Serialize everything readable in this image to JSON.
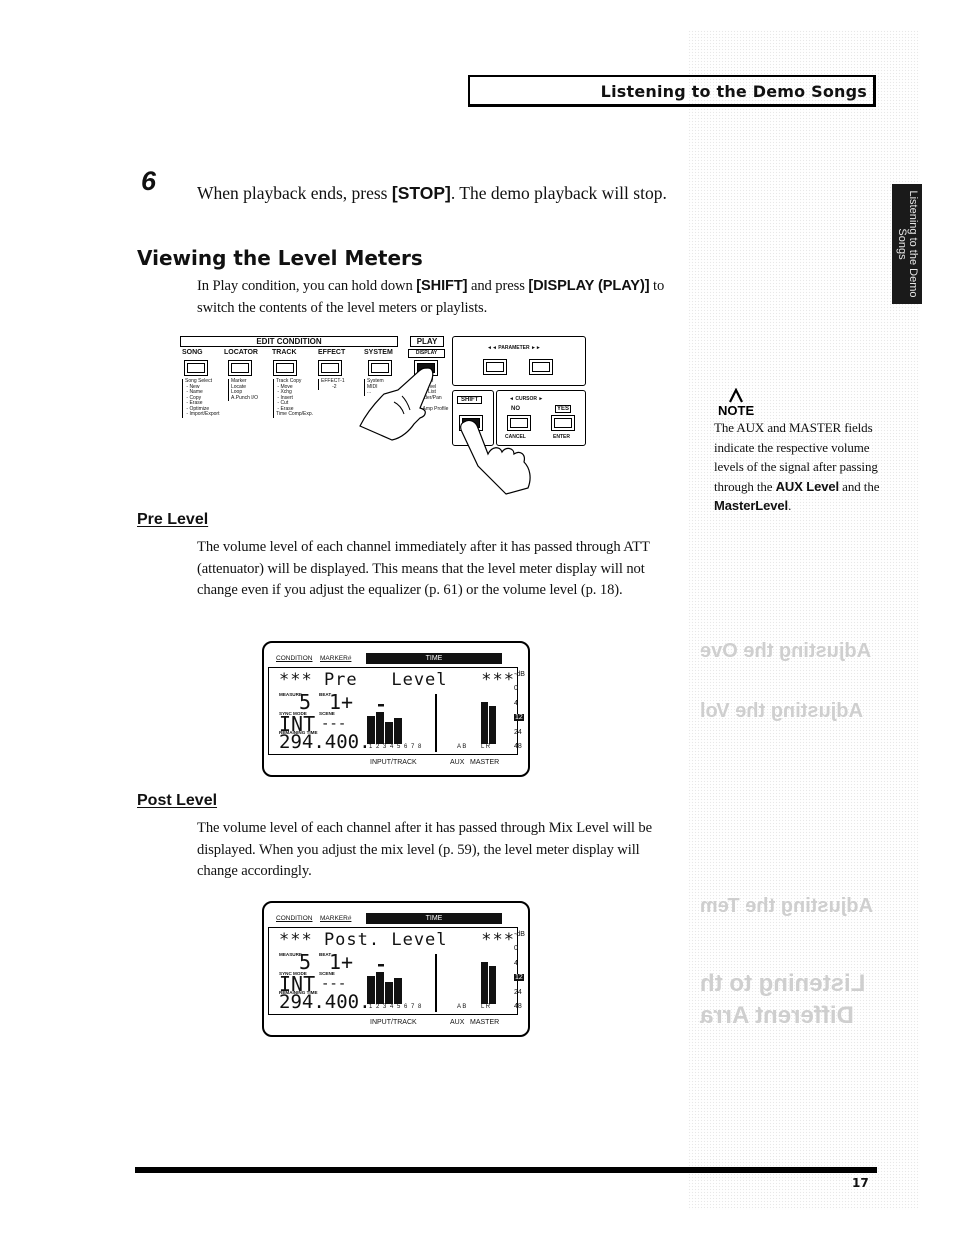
{
  "header": {
    "title": "Listening to the Demo Songs"
  },
  "side_tab": {
    "label": "Listening to the Demo Songs"
  },
  "step": {
    "number": "6",
    "text_pre": "When playback ends, press ",
    "text_bold": "[STOP]",
    "text_post": ". The demo playback will stop."
  },
  "section": {
    "title": "Viewing the Level Meters",
    "intro_pre": "In Play condition, you can hold down ",
    "intro_bold1": "[SHIFT]",
    "intro_mid": " and press ",
    "intro_bold2": "[DISPLAY (PLAY)]",
    "intro_post": " to switch the contents of the level meters or playlists."
  },
  "panel": {
    "edit_condition": "EDIT CONDITION",
    "play": "PLAY",
    "display": "DISPLAY",
    "categories": [
      "SONG",
      "LOCATOR",
      "TRACK",
      "EFFECT",
      "SYSTEM"
    ],
    "song_sub": "Song Select\n - New\n - Name\n - Copy\n - Erase\n - Optimize\n - Import/Export",
    "locator_sub": "Marker\nLocate\nLoop\nA.Punch I/O",
    "track_sub": "Track Copy\n - Move\n - Xchg\n - Insert\n - Cut\n - Erase\nTime Comp/Exp.",
    "effect_sub": "EFFECT-1\n        -2",
    "system_sub": "System\nMIDI\n...",
    "play_sub": "...evel\n...Level\n...y List\n...der/Pan\n\nI Amp Profile",
    "parameter": "PARAMETER",
    "shift": "SHIFT",
    "cursor": "CURSOR",
    "no": "NO",
    "yes": "YES",
    "cancel": "CANCEL",
    "enter": "ENTER"
  },
  "pre_level": {
    "title": "Pre Level",
    "text": "The volume level of each channel immediately after it has passed through ATT (attenuator) will be displayed. This means that the level meter display will not change even if you adjust the equalizer (p. 61) or the volume level (p. 18)."
  },
  "post_level": {
    "title": "Post Level",
    "text": "The volume level of each channel after it has passed through Mix Level will be displayed. When you adjust the mix level (p. 59), the level meter display will change accordingly."
  },
  "lcd_pre": {
    "condition": "CONDITION",
    "marker": "MARKER#",
    "time": "TIME",
    "title": "*** Pre   Level   ***",
    "measure_label": "MEASURE",
    "measure": "5",
    "beat_label": "BEAT",
    "beat": "1+",
    "sync_label": "SYNC MODE",
    "sync": "INT",
    "scene_label": "SCENE",
    "scene": "---",
    "remaining_label": "REMAINING TIME",
    "remaining": "294.400.",
    "channels": "1 2 3 4 5 6 7 8",
    "aux_ch": "A B",
    "master_ch": "L R",
    "input_track": "INPUT/TRACK",
    "aux": "AUX",
    "master": "MASTER",
    "db_unit": "-dB",
    "db_scale": [
      "0",
      "4",
      "12",
      "24",
      "48"
    ]
  },
  "lcd_post": {
    "condition": "CONDITION",
    "marker": "MARKER#",
    "time": "TIME",
    "title": "*** Post. Level   ***",
    "measure_label": "MEASURE",
    "measure": "5",
    "beat_label": "BEAT",
    "beat": "1+",
    "sync_label": "SYNC MODE",
    "sync": "INT",
    "scene_label": "SCENE",
    "scene": "---",
    "remaining_label": "REMAINING TIME",
    "remaining": "294.400.",
    "channels": "1 2 3 4 5 6 7 8",
    "aux_ch": "A B",
    "master_ch": "L R",
    "input_track": "INPUT/TRACK",
    "aux": "AUX",
    "master": "MASTER",
    "db_unit": "-dB",
    "db_scale": [
      "0",
      "4",
      "12",
      "24",
      "48"
    ]
  },
  "note": {
    "label": "NOTE",
    "text_pre": "The AUX and MASTER fields indicate the respective volume levels of the signal after passing through the ",
    "bold1": "AUX Level",
    "mid": " and the ",
    "bold2": "MasterLevel",
    "post": "."
  },
  "footer": {
    "page_number": "17"
  }
}
